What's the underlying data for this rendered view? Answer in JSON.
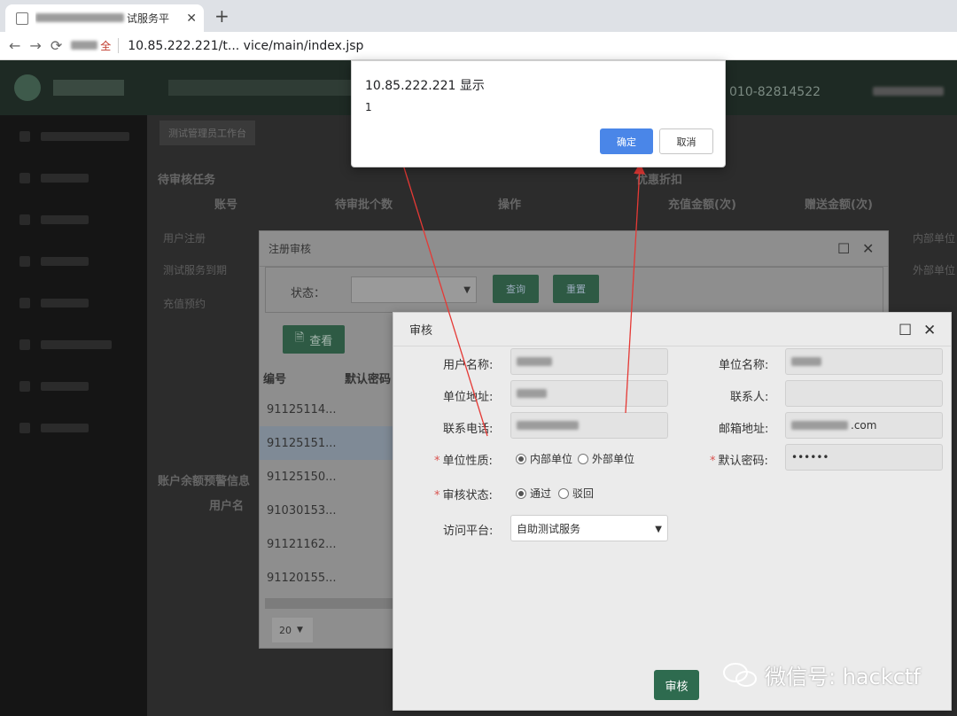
{
  "browser": {
    "tab_title": "试服务平",
    "url": "10.85.222.221/t... vice/main/index.jsp",
    "secure_label": "全"
  },
  "app": {
    "phone": "010-82814522",
    "breadcrumb": "测试管理员工作台",
    "pending_tasks_title": "待审核任务",
    "table_headers": [
      "账号",
      "待审批个数",
      "操作",
      "充值金额(次)",
      "赠送金额(次)"
    ],
    "task_rows": [
      "用户注册",
      "测试服务到期",
      "充值预约"
    ],
    "discount_title": "优惠折扣",
    "right_col": [
      "内部单位",
      "外部单位"
    ],
    "balance_title": "账户余额预警信息",
    "balance_col": "用户名"
  },
  "register_dialog": {
    "title": "注册审核",
    "status_label": "状态：",
    "query_button": "查询",
    "reset_button": "重置",
    "view_button": "查看",
    "col_id": "编号",
    "col_password": "默认密码",
    "rows": [
      "91125114...",
      "91125151...",
      "91125150...",
      "91030153...",
      "91121162...",
      "91120155..."
    ],
    "page_size": "20"
  },
  "audit_dialog": {
    "title": "审核",
    "labels": {
      "user_name": "用户名称:",
      "unit_name": "单位名称:",
      "unit_address": "单位地址:",
      "contact": "联系人:",
      "phone": "联系电话:",
      "email": "邮箱地址:",
      "unit_type": "单位性质:",
      "default_password": "默认密码:",
      "audit_status": "审核状态:",
      "platform": "访问平台:"
    },
    "values": {
      "email_suffix": ".com",
      "password": "••••••",
      "platform": "自助测试服务"
    },
    "unit_type_options": [
      "内部单位",
      "外部单位"
    ],
    "audit_status_options": [
      "通过",
      "驳回"
    ],
    "submit_button": "审核"
  },
  "alert": {
    "title": "10.85.222.221 显示",
    "message": "1",
    "ok_button": "确定",
    "cancel_button": "取消"
  },
  "watermark": {
    "text": "微信号: hackctf"
  }
}
